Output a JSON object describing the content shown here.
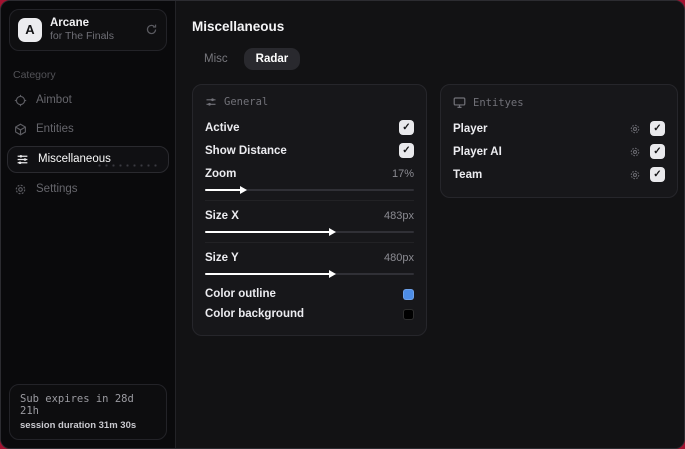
{
  "sidebar": {
    "brand": {
      "initial": "A",
      "title": "Arcane",
      "subtitle": "for The Finals"
    },
    "category_label": "Category",
    "items": [
      {
        "label": "Aimbot"
      },
      {
        "label": "Entities"
      },
      {
        "label": "Miscellaneous"
      },
      {
        "label": "Settings"
      }
    ],
    "footer": {
      "line1": "Sub expires in 28d 21h",
      "line2": "session duration 31m 30s"
    }
  },
  "main": {
    "title": "Miscellaneous",
    "tabs": [
      {
        "label": "Misc"
      },
      {
        "label": "Radar"
      }
    ],
    "general_panel": {
      "title": "General",
      "toggles": [
        {
          "label": "Active",
          "checked": true
        },
        {
          "label": "Show Distance",
          "checked": true
        }
      ],
      "sliders": [
        {
          "label": "Zoom",
          "value": "17%",
          "fill": 17
        },
        {
          "label": "Size X",
          "value": "483px",
          "fill": 60
        },
        {
          "label": "Size Y",
          "value": "480px",
          "fill": 60
        }
      ],
      "colors": [
        {
          "label": "Color outline",
          "color": "#4d8de6"
        },
        {
          "label": "Color background",
          "color": "#000000"
        }
      ]
    },
    "entities_panel": {
      "title": "Entityes",
      "rows": [
        {
          "label": "Player",
          "checked": true
        },
        {
          "label": "Player AI",
          "checked": true
        },
        {
          "label": "Team",
          "checked": true
        }
      ]
    }
  },
  "icons": {
    "check": "✓"
  },
  "colors": {
    "accent_blue": "#4d8de6",
    "backdrop_red": "#a31230"
  }
}
